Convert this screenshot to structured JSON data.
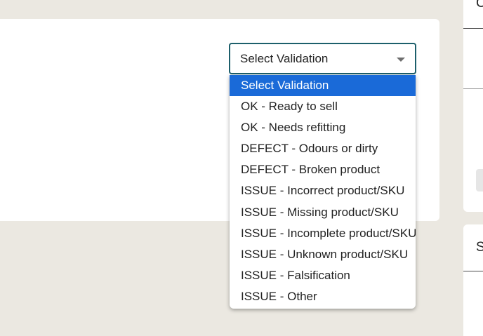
{
  "colors": {
    "background": "#ebe8e1",
    "card": "#ffffff",
    "select_border": "#1d5f6b",
    "highlight": "#1a6ad8"
  },
  "right_panel": {
    "top_heading": "C",
    "bottom_heading": "S"
  },
  "validation_select": {
    "selected": "Select Validation",
    "caret_icon": "caret-down-icon",
    "options": [
      "Select Validation",
      "OK - Ready to sell",
      "OK - Needs refitting",
      "DEFECT - Odours or dirty",
      "DEFECT - Broken product",
      "ISSUE - Incorrect product/SKU",
      "ISSUE - Missing product/SKU",
      "ISSUE - Incomplete product/SKU",
      "ISSUE - Unknown product/SKU",
      "ISSUE - Falsification",
      "ISSUE - Other"
    ],
    "highlighted_index": 0
  }
}
